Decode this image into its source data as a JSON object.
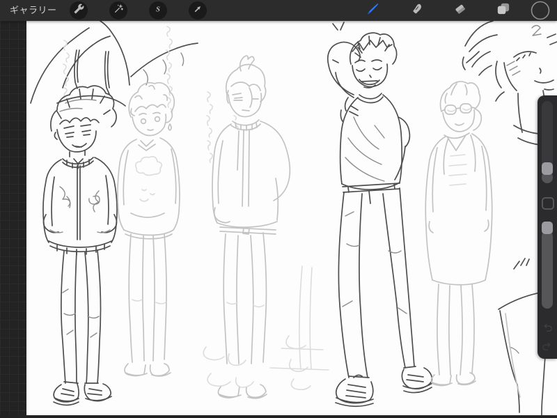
{
  "topbar": {
    "gallery_label": "ギャラリー",
    "left_tools": [
      {
        "id": "actions",
        "icon": "wrench-icon"
      },
      {
        "id": "adjustments",
        "icon": "magic-wand-icon"
      },
      {
        "id": "selection",
        "icon": "s-curve-icon"
      },
      {
        "id": "transform",
        "icon": "arrow-cursor-icon"
      }
    ],
    "right_tools": [
      {
        "id": "paint",
        "icon": "brush-icon",
        "active": true
      },
      {
        "id": "smudge",
        "icon": "smudge-finger-icon",
        "active": false
      },
      {
        "id": "erase",
        "icon": "eraser-icon",
        "active": false
      },
      {
        "id": "layers",
        "icon": "layers-icon",
        "active": false
      },
      {
        "id": "color",
        "icon": "color-circle-icon",
        "active": false
      }
    ]
  },
  "sidebar": {
    "brush_size_slider": {
      "handle_fraction_from_top": 0.88
    },
    "opacity_slider": {
      "handle_fraction_from_top": 0.0
    },
    "has_modify_button": true,
    "undo_visible": true,
    "redo_visible": true
  },
  "canvas": {
    "content": "graphite pencil character-study page: five standing boys (sukajan-jacket boy, fluffy-hair sweater boy, ahoge jacket boy, grinning boy with arm behind head, glasses boy with ponytail), partial hoodie sketch top-left, partial smiling face top-right, partial shoulder bottom-right, faint vertical handwritten notes"
  },
  "colors": {
    "accent_blue": "#2f7bf5",
    "topbar_bg": "#2c2c2c",
    "pasteboard_bg": "#232323",
    "sidebar_bg": "#2b2b2d",
    "canvas_bg": "#fdfdfd",
    "icon_gray": "#b9b9b9",
    "slider_handle": "#9c9ca0"
  }
}
